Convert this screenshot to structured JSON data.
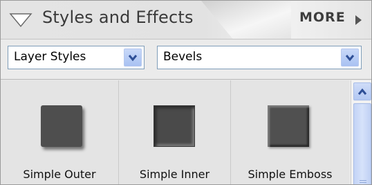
{
  "header": {
    "title": "Styles and Effects",
    "more_label": "MORE"
  },
  "dropdowns": {
    "category": {
      "value": "Layer Styles"
    },
    "type": {
      "value": "Bevels"
    }
  },
  "styles": [
    {
      "label": "Simple Outer"
    },
    {
      "label": "Simple Inner"
    },
    {
      "label": "Simple Emboss"
    }
  ],
  "icons": {
    "collapse": "triangle-down-icon",
    "more": "triangle-right-icon",
    "dropdown": "chevron-down-icon",
    "scroll_up": "chevron-up-icon"
  },
  "colors": {
    "panel_bg": "#e9e9e9",
    "accent_blue": "#a9c2f2",
    "thumb_gray": "#4e4e4e"
  }
}
